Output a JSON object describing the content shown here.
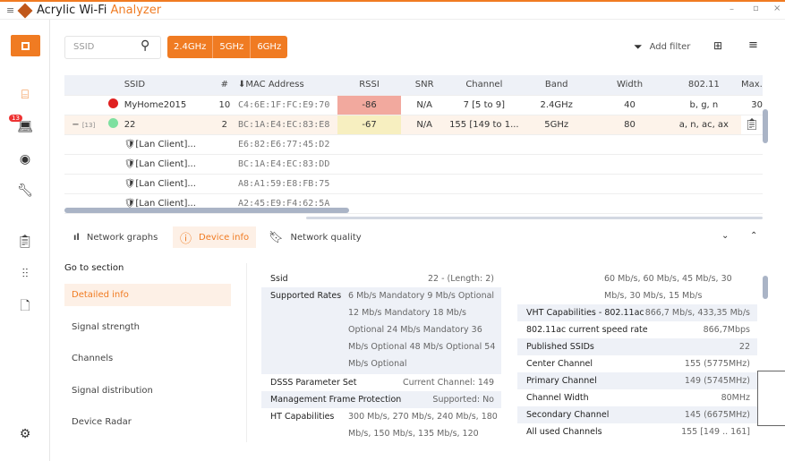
{
  "app": {
    "title_main": "Acrylic Wi-Fi ",
    "title_accent": "Analyzer",
    "menu_icon": "hamburger-icon",
    "logo_icon": "acrylic-logo-icon"
  },
  "window": {
    "minimize": "–",
    "maximize": "▫",
    "close": "×"
  },
  "sidebar": {
    "items": [
      "stop-icon",
      "router-icon",
      "laptop-icon",
      "eye-icon",
      "wrench-icon",
      "clipboard-icon",
      "equalizer-icon",
      "document-icon",
      "gear-icon"
    ],
    "badge": "13"
  },
  "toolbar": {
    "search_placeholder": "SSID",
    "bands": [
      "2.4GHz",
      "5GHz",
      "6GHz"
    ],
    "add_filter": "Add filter"
  },
  "table": {
    "headers": [
      "SSID",
      "#",
      "⬇MAC Address",
      "RSSI",
      "SNR",
      "Channel",
      "Band",
      "Width",
      "802.11",
      "Max."
    ],
    "rows": [
      {
        "expander": "",
        "count": "",
        "dot": "#e02020",
        "ssid": "MyHome2015",
        "n": "10",
        "mac": "C4:6E:1F:FC:E9:70",
        "rssi": "-86",
        "rssi_bg": "#f2a99e",
        "snr": "N/A",
        "channel": "7 [5 to 9]",
        "band": "2.4GHz",
        "width": "40",
        "std": "b, g, n",
        "max": "30"
      },
      {
        "expander": "−",
        "count": "[13]",
        "dot": "#7ee0a0",
        "ssid": "22",
        "n": "2",
        "mac": "BC:1A:E4:EC:83:E8",
        "rssi": "-67",
        "rssi_bg": "#f7efc0",
        "snr": "N/A",
        "channel": "155 [149 to 1...",
        "band": "5GHz",
        "width": "80",
        "std": "a, n, ac, ax",
        "max": ""
      },
      {
        "ssid": "[Lan Client]...",
        "mac": "E6:82:E6:77:45:D2"
      },
      {
        "ssid": "[Lan Client]...",
        "mac": "BC:1A:E4:EC:83:DD"
      },
      {
        "ssid": "[Lan Client]...",
        "mac": "A8:A1:59:E8:FB:75"
      },
      {
        "ssid": "[Lan Client]...",
        "mac": "A2:45:E9:F4:62:5A"
      }
    ]
  },
  "tabs": [
    "Network graphs",
    "Device info",
    "Network quality"
  ],
  "nav": {
    "title": "Go to section",
    "items": [
      "Detailed info",
      "Signal strength",
      "Channels",
      "Signal distribution",
      "Device Radar"
    ]
  },
  "details_left": [
    {
      "k": "Ssid",
      "v": "22 - (Length: 2)"
    },
    {
      "k": "Supported Rates",
      "v": [
        "6 Mb/s Mandatory 9 Mb/s Optional",
        "12 Mb/s Mandatory 18 Mb/s",
        "Optional 24 Mb/s Mandatory 36",
        "Mb/s Optional 48 Mb/s Optional 54",
        "Mb/s Optional"
      ]
    },
    {
      "k": "DSSS Parameter Set",
      "v": "Current Channel: 149"
    },
    {
      "k": "Management Frame Protection",
      "v": "Supported: No"
    },
    {
      "k": "HT Capabilities",
      "v": [
        "300 Mb/s, 270 Mb/s, 240 Mb/s, 180",
        "Mb/s, 150 Mb/s, 135 Mb/s, 120"
      ]
    }
  ],
  "details_right": {
    "cont": [
      "60 Mb/s, 60 Mb/s, 45 Mb/s, 30",
      "Mb/s, 30 Mb/s, 15 Mb/s"
    ],
    "rows": [
      {
        "k": "VHT Capabilities - 802.11ac",
        "v": "866,7 Mb/s, 433,35 Mb/s"
      },
      {
        "k": "802.11ac current speed rate",
        "v": "866,7Mbps"
      },
      {
        "k": "Published SSIDs",
        "v": "22"
      },
      {
        "k": "Center Channel",
        "v": "155 (5775MHz)"
      },
      {
        "k": "Primary Channel",
        "v": "149 (5745MHz)"
      },
      {
        "k": "Channel Width",
        "v": "80MHz"
      },
      {
        "k": "Secondary Channel",
        "v": "145 (6675MHz)"
      },
      {
        "k": "All used Channels",
        "v": "155 [149 .. 161]"
      }
    ]
  }
}
